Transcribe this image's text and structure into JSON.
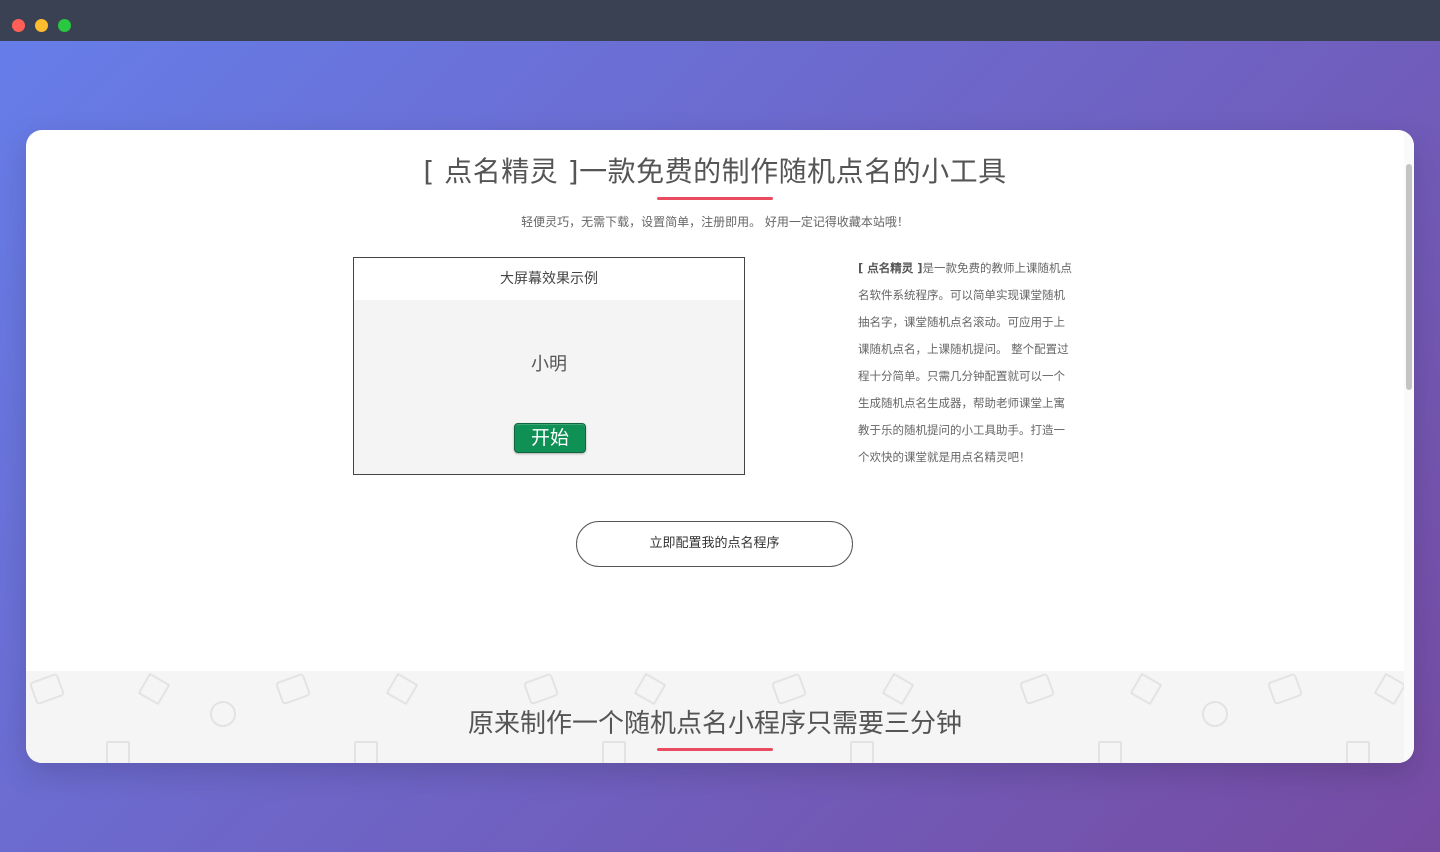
{
  "window": {
    "buttons": [
      "close",
      "minimize",
      "maximize"
    ]
  },
  "hero": {
    "title": "[ 点名精灵 ]一款免费的制作随机点名的小工具",
    "subtitle": "轻便灵巧，无需下载，设置简单，注册即用。 好用一定记得收藏本站哦！"
  },
  "demo": {
    "header": "大屏幕效果示例",
    "name": "小明",
    "start_label": "开始"
  },
  "description": {
    "brand": "[ 点名精灵 ]",
    "text": "是一款免费的教师上课随机点名软件系统程序。可以简单实现课堂随机抽名字，课堂随机点名滚动。可应用于上课随机点名，上课随机提问。 整个配置过程十分简单。只需几分钟配置就可以一个生成随机点名生成器，帮助老师课堂上寓教于乐的随机提问的小工具助手。打造一个欢快的课堂就是用点名精灵吧！"
  },
  "cta": {
    "label": "立即配置我的点名程序"
  },
  "section2": {
    "title": "原来制作一个随机点名小程序只需要三分钟"
  },
  "colors": {
    "accent": "#e84c5e",
    "start_button": "#0f9055"
  }
}
